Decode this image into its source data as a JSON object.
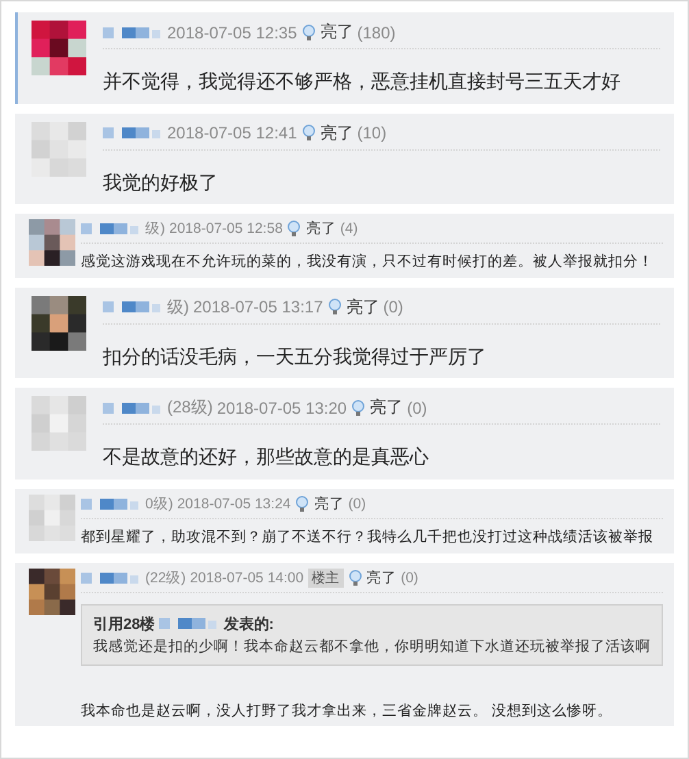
{
  "comments": [
    {
      "kind": "large",
      "highlighted": true,
      "date": "2018-07-05 12:35",
      "light_label": "亮了",
      "light_count": "(180)",
      "text": "并不觉得，我觉得还不够严格，恶意挂机直接封号三五天才好"
    },
    {
      "kind": "large",
      "highlighted": false,
      "date": "2018-07-05 12:41",
      "light_label": "亮了",
      "light_count": "(10)",
      "text": "我觉的好极了"
    },
    {
      "kind": "compact",
      "highlighted": false,
      "level": "级)",
      "date": "2018-07-05 12:58",
      "light_label": "亮了",
      "light_count": "(4)",
      "text": "感觉这游戏现在不允许玩的菜的，我没有演，只不过有时候打的差。被人举报就扣分！"
    },
    {
      "kind": "large",
      "highlighted": false,
      "level": "级)",
      "date": "2018-07-05 13:17",
      "light_label": "亮了",
      "light_count": "(0)",
      "text": "扣分的话没毛病，一天五分我觉得过于严厉了"
    },
    {
      "kind": "large",
      "highlighted": false,
      "level": "(28级)",
      "date": "2018-07-05 13:20",
      "light_label": "亮了",
      "light_count": "(0)",
      "text": "不是故意的还好，那些故意的是真恶心"
    },
    {
      "kind": "compact",
      "highlighted": false,
      "level": "0级)",
      "date": "2018-07-05 13:24",
      "light_label": "亮了",
      "light_count": "(0)",
      "text": "都到星耀了，助攻混不到？崩了不送不行？我特么几千把也没打过这种战绩活该被举报"
    },
    {
      "kind": "compact",
      "highlighted": false,
      "level": "(22级)",
      "date": "2018-07-05 14:00",
      "light_label": "亮了",
      "light_count": "(0)",
      "host_badge": "楼主",
      "quote": {
        "prefix": "引用28楼",
        "suffix": "发表的:",
        "text": "我感觉还是扣的少啊！我本命赵云都不拿他，你明明知道下水道还玩被举报了活该啊"
      },
      "text": "我本命也是赵云啊，没人打野了我才拿出来，三省金牌赵云。 没想到这么惨呀。"
    }
  ]
}
